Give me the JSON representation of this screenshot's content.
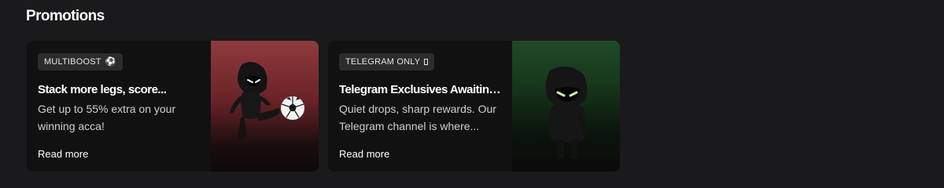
{
  "section": {
    "title": "Promotions"
  },
  "promotions": [
    {
      "badge": "MULTIBOOST",
      "badge_icon": "soccer-ball-icon",
      "title": "Stack more legs, score...",
      "description": "Get up to 55% extra on your winning acca!",
      "link": "Read more",
      "media_color": "#8f3b3e"
    },
    {
      "badge": "TELEGRAM ONLY",
      "badge_icon": "missing-glyph-icon",
      "title": "Telegram Exclusives Awaiting...",
      "description": "Quiet drops, sharp rewards. Our Telegram channel is where...",
      "link": "Read more",
      "media_color": "#1f4a27"
    }
  ]
}
